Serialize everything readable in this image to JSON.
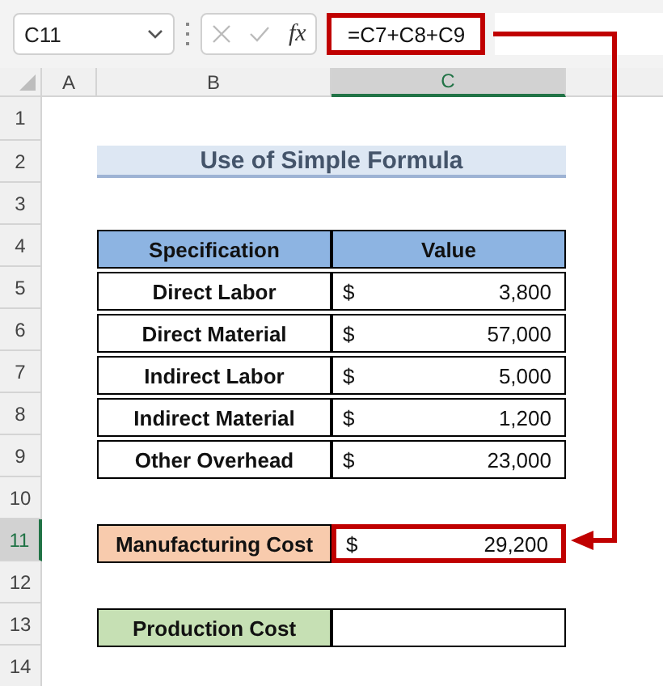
{
  "formula_bar": {
    "name_box": "C11",
    "fx": "fx",
    "formula": "=C7+C8+C9"
  },
  "columns": [
    {
      "label": "A",
      "selected": false
    },
    {
      "label": "B",
      "selected": false
    },
    {
      "label": "C",
      "selected": true
    }
  ],
  "rows": [
    {
      "label": "1",
      "selected": false
    },
    {
      "label": "2",
      "selected": false
    },
    {
      "label": "3",
      "selected": false
    },
    {
      "label": "4",
      "selected": false
    },
    {
      "label": "5",
      "selected": false
    },
    {
      "label": "6",
      "selected": false
    },
    {
      "label": "7",
      "selected": false
    },
    {
      "label": "8",
      "selected": false
    },
    {
      "label": "9",
      "selected": false
    },
    {
      "label": "10",
      "selected": false
    },
    {
      "label": "11",
      "selected": true
    },
    {
      "label": "12",
      "selected": false
    },
    {
      "label": "13",
      "selected": false
    },
    {
      "label": "14",
      "selected": false
    }
  ],
  "title": "Use of Simple Formula",
  "table": {
    "columns": [
      "Specification",
      "Value"
    ],
    "rows": [
      {
        "label": "Direct Labor",
        "currency": "$",
        "value": "3,800"
      },
      {
        "label": "Direct Material",
        "currency": "$",
        "value": "57,000"
      },
      {
        "label": "Indirect Labor",
        "currency": "$",
        "value": "5,000"
      },
      {
        "label": "Indirect Material",
        "currency": "$",
        "value": "1,200"
      },
      {
        "label": "Other Overhead",
        "currency": "$",
        "value": "23,000"
      }
    ]
  },
  "manufacturing": {
    "label": "Manufacturing Cost",
    "currency": "$",
    "value": "29,200",
    "selected": true
  },
  "production": {
    "label": "Production Cost"
  }
}
